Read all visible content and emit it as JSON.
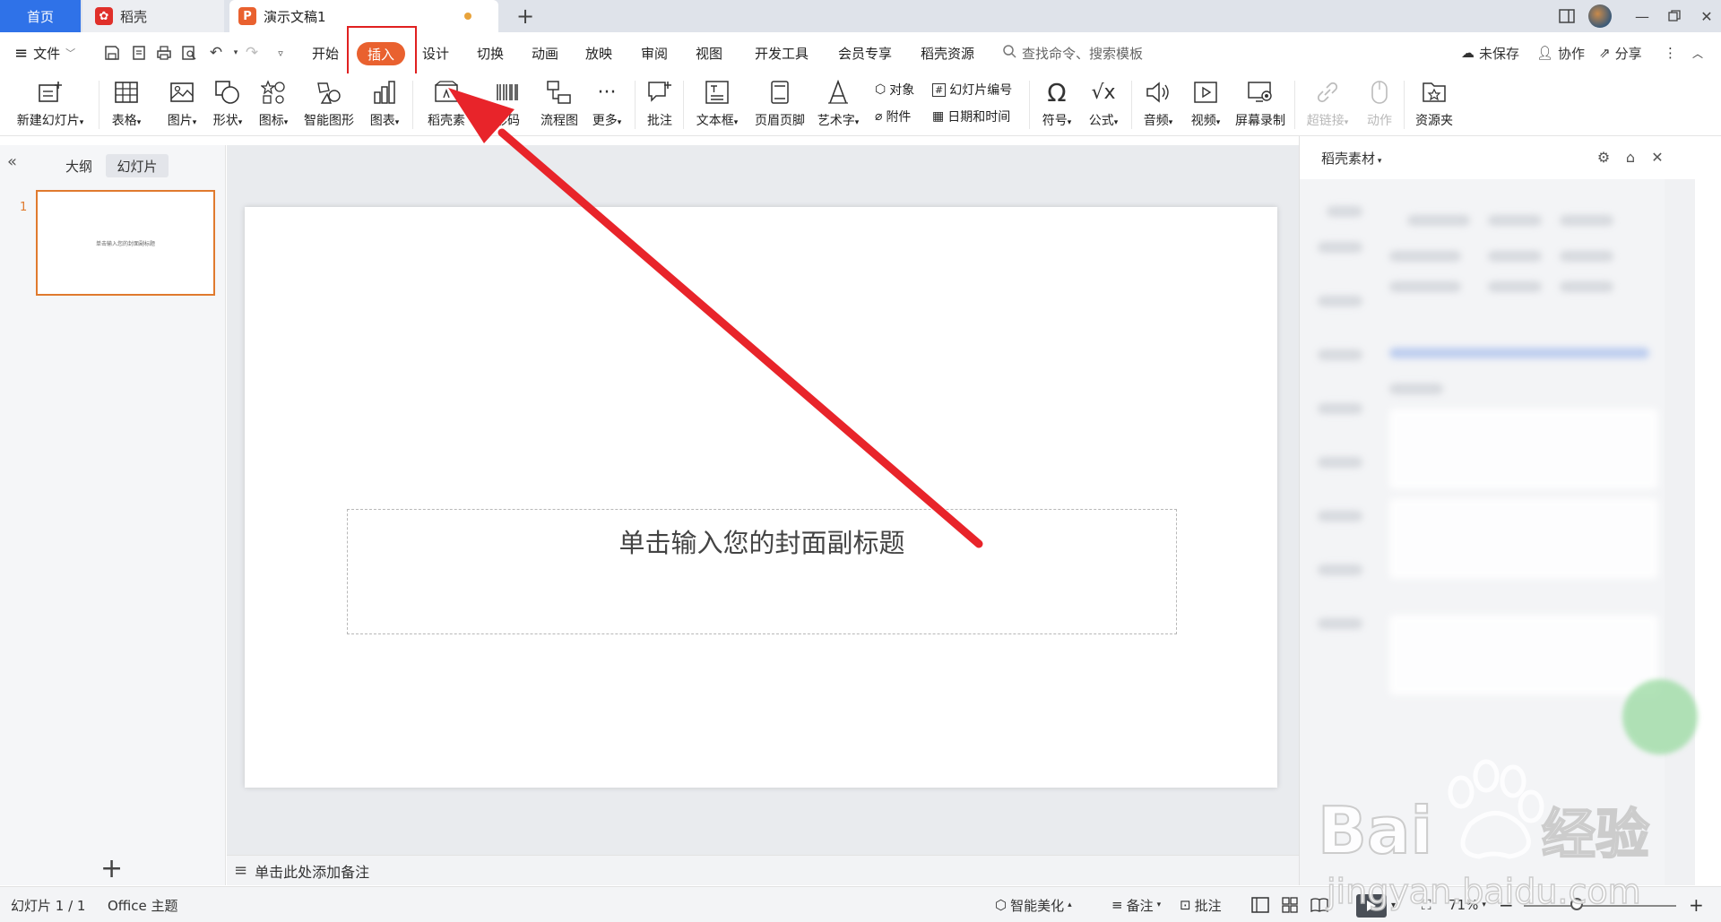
{
  "tabs": {
    "home": "首页",
    "daoke": "稻壳",
    "doc": "演示文稿1"
  },
  "menu": {
    "file": "文件",
    "items": [
      "开始",
      "插入",
      "设计",
      "切换",
      "动画",
      "放映",
      "审阅",
      "视图",
      "开发工具",
      "会员专享",
      "稻壳资源"
    ],
    "search_placeholder": "查找命令、搜索模板",
    "unsaved": "未保存",
    "collab": "协作",
    "share": "分享"
  },
  "ribbon": {
    "new_slide": "新建幻灯片",
    "table": "表格",
    "picture": "图片",
    "shape": "形状",
    "icon": "图标",
    "smart_art": "智能图形",
    "chart": "图表",
    "daoke_material": "稻壳素",
    "barcode": "形码",
    "flowchart": "流程图",
    "more": "更多",
    "comment": "批注",
    "textbox": "文本框",
    "header_footer": "页眉页脚",
    "word_art": "艺术字",
    "object": "对象",
    "attachment": "附件",
    "slide_number": "幻灯片编号",
    "date_time": "日期和时间",
    "symbol": "符号",
    "formula": "公式",
    "audio": "音频",
    "video": "视频",
    "screen_record": "屏幕录制",
    "hyperlink": "超链接",
    "action": "动作",
    "resource_folder": "资源夹"
  },
  "leftpane": {
    "outline_tab": "大纲",
    "slides_tab": "幻灯片",
    "slide_number": "1",
    "thumb_text": "单击输入您的封面副标题",
    "add": "+"
  },
  "slide": {
    "subtitle_placeholder": "单击输入您的封面副标题"
  },
  "notes": {
    "placeholder": "单击此处添加备注"
  },
  "rightpanel": {
    "title": "稻壳素材"
  },
  "status": {
    "slide_count": "幻灯片 1 / 1",
    "theme": "Office 主题",
    "beautify": "智能美化",
    "notes": "备注",
    "comments": "批注",
    "zoom": "71%"
  },
  "watermark": {
    "brand": "Bai du 经验",
    "url": "jingyan.baidu.com"
  },
  "colors": {
    "accent": "#e9612f",
    "home_tab": "#2f72e8",
    "annotation": "#e02020",
    "thumb_border": "#e07a2e"
  }
}
